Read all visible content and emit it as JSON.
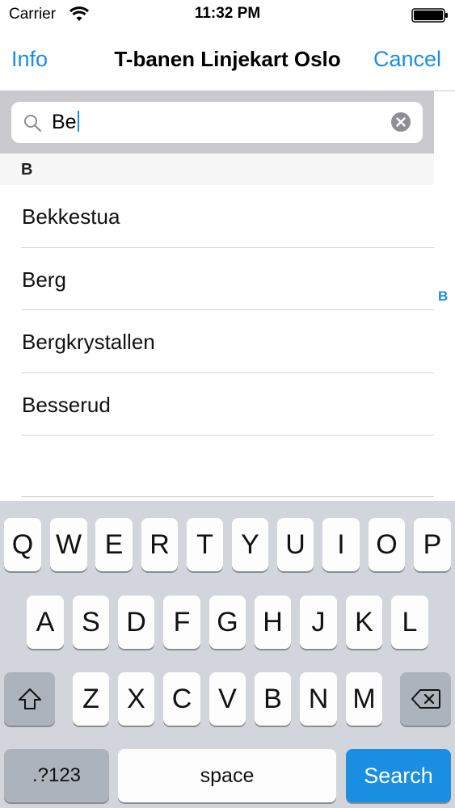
{
  "status_bar": {
    "carrier": "Carrier",
    "time": "11:32 PM"
  },
  "nav": {
    "left_label": "Info",
    "title": "T-banen Linjekart Oslo",
    "right_label": "Cancel"
  },
  "search": {
    "value": "Be",
    "icon": "search-icon",
    "clear_icon": "clear-icon"
  },
  "section": {
    "letter": "B"
  },
  "results": [
    {
      "label": "Bekkestua"
    },
    {
      "label": "Berg"
    },
    {
      "label": "Bergkrystallen"
    },
    {
      "label": "Besserud"
    }
  ],
  "index": [
    "B"
  ],
  "keyboard": {
    "row1": [
      "Q",
      "W",
      "E",
      "R",
      "T",
      "Y",
      "U",
      "I",
      "O",
      "P"
    ],
    "row2": [
      "A",
      "S",
      "D",
      "F",
      "G",
      "H",
      "J",
      "K",
      "L"
    ],
    "row3": [
      "Z",
      "X",
      "C",
      "V",
      "B",
      "N",
      "M"
    ],
    "numbers_label": ".?123",
    "space_label": "space",
    "search_label": "Search",
    "shift_icon": "shift-icon",
    "delete_icon": "delete-icon"
  },
  "colors": {
    "accent": "#1a8ee0",
    "keyboard_bg": "#d2d5db",
    "search_bar_bg": "#c9c9ce"
  }
}
